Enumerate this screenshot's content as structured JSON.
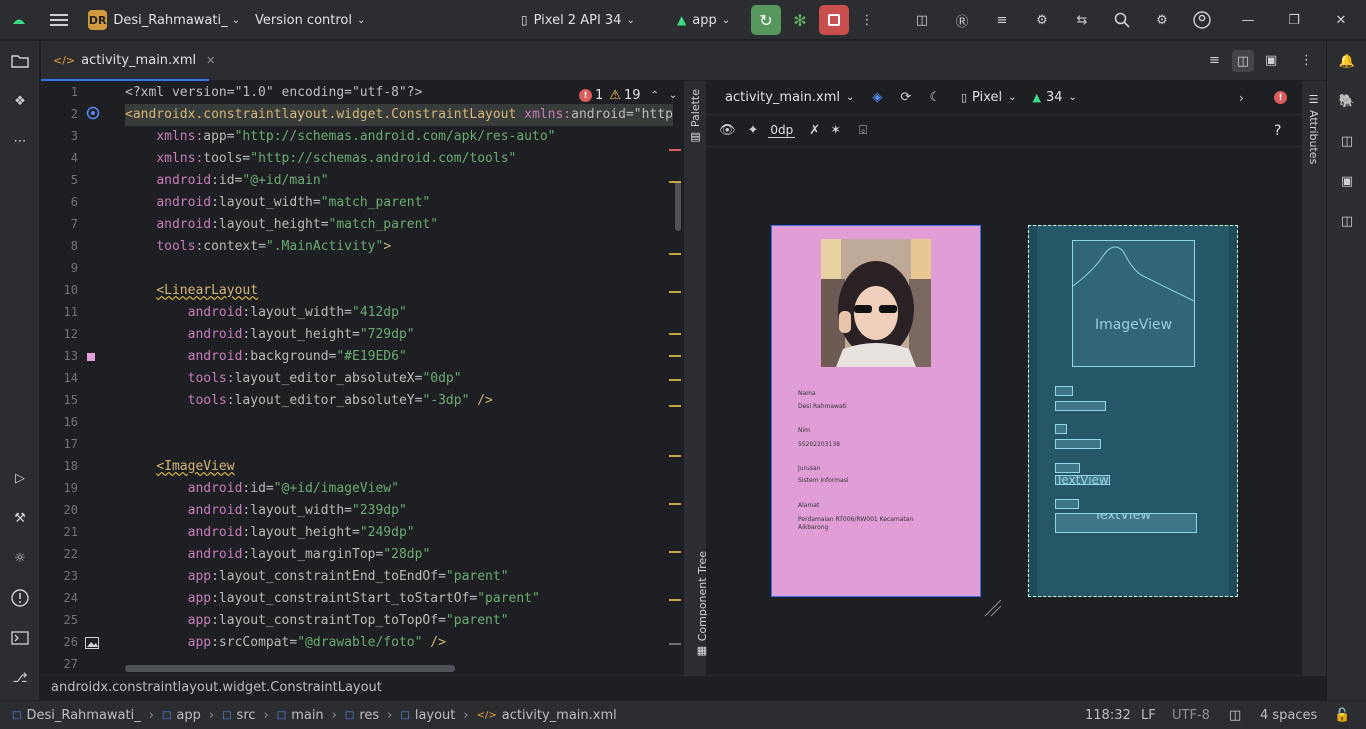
{
  "titlebar": {
    "project_badge": "DR",
    "project_name": "Desi_Rahmawati_",
    "vcs": "Version control",
    "device": "Pixel 2 API 34",
    "run_config": "app"
  },
  "tab": {
    "label": "activity_main.xml"
  },
  "editor": {
    "problems_errors": "1",
    "problems_warnings": "19",
    "line_numbers": [
      "1",
      "2",
      "3",
      "4",
      "5",
      "6",
      "7",
      "8",
      "9",
      "10",
      "11",
      "12",
      "13",
      "14",
      "15",
      "16",
      "17",
      "18",
      "19",
      "20",
      "21",
      "22",
      "23",
      "24",
      "25",
      "26",
      "27"
    ],
    "lines": [
      [
        {
          "c": "t-plain",
          "t": "<?xml version=\"1.0\" encoding=\"utf-8\"?>"
        }
      ],
      [
        {
          "c": "t-tag",
          "t": "<androidx.constraintlayout.widget.ConstraintLayout "
        },
        {
          "c": "t-ns",
          "t": "xmlns:"
        },
        {
          "c": "t-attr",
          "t": "android"
        },
        {
          "c": "t-plain",
          "t": "=\"http"
        }
      ],
      [
        {
          "c": "t-plain",
          "t": "    "
        },
        {
          "c": "t-ns",
          "t": "xmlns:"
        },
        {
          "c": "t-attr",
          "t": "app"
        },
        {
          "c": "t-plain",
          "t": "="
        },
        {
          "c": "t-val",
          "t": "\"http://schemas.android.com/apk/res-auto\""
        }
      ],
      [
        {
          "c": "t-plain",
          "t": "    "
        },
        {
          "c": "t-ns",
          "t": "xmlns:"
        },
        {
          "c": "t-attr",
          "t": "tools"
        },
        {
          "c": "t-plain",
          "t": "="
        },
        {
          "c": "t-val",
          "t": "\"http://schemas.android.com/tools\""
        }
      ],
      [
        {
          "c": "t-plain",
          "t": "    "
        },
        {
          "c": "t-ns",
          "t": "android"
        },
        {
          "c": "t-attr",
          "t": ":id"
        },
        {
          "c": "t-plain",
          "t": "="
        },
        {
          "c": "t-val",
          "t": "\"@+id/main\""
        }
      ],
      [
        {
          "c": "t-plain",
          "t": "    "
        },
        {
          "c": "t-ns",
          "t": "android"
        },
        {
          "c": "t-attr",
          "t": ":layout_width"
        },
        {
          "c": "t-plain",
          "t": "="
        },
        {
          "c": "t-val",
          "t": "\"match_parent\""
        }
      ],
      [
        {
          "c": "t-plain",
          "t": "    "
        },
        {
          "c": "t-ns",
          "t": "android"
        },
        {
          "c": "t-attr",
          "t": ":layout_height"
        },
        {
          "c": "t-plain",
          "t": "="
        },
        {
          "c": "t-val",
          "t": "\"match_parent\""
        }
      ],
      [
        {
          "c": "t-plain",
          "t": "    "
        },
        {
          "c": "t-ns",
          "t": "tools"
        },
        {
          "c": "t-attr",
          "t": ":context"
        },
        {
          "c": "t-plain",
          "t": "="
        },
        {
          "c": "t-val",
          "t": "\".MainActivity\""
        },
        {
          "c": "t-tag",
          "t": ">"
        }
      ],
      [
        {
          "c": "t-plain",
          "t": ""
        }
      ],
      [
        {
          "c": "t-plain",
          "t": "    "
        },
        {
          "c": "t-tag",
          "t": "<LinearLayout"
        }
      ],
      [
        {
          "c": "t-plain",
          "t": "        "
        },
        {
          "c": "t-ns",
          "t": "android"
        },
        {
          "c": "t-attr",
          "t": ":layout_width"
        },
        {
          "c": "t-plain",
          "t": "="
        },
        {
          "c": "t-val",
          "t": "\"412dp\""
        }
      ],
      [
        {
          "c": "t-plain",
          "t": "        "
        },
        {
          "c": "t-ns",
          "t": "android"
        },
        {
          "c": "t-attr",
          "t": ":layout_height"
        },
        {
          "c": "t-plain",
          "t": "="
        },
        {
          "c": "t-val",
          "t": "\"729dp\""
        }
      ],
      [
        {
          "c": "t-plain",
          "t": "        "
        },
        {
          "c": "t-ns",
          "t": "android"
        },
        {
          "c": "t-attr",
          "t": ":background"
        },
        {
          "c": "t-plain",
          "t": "="
        },
        {
          "c": "t-val",
          "t": "\"#E19ED6\""
        }
      ],
      [
        {
          "c": "t-plain",
          "t": "        "
        },
        {
          "c": "t-ns",
          "t": "tools"
        },
        {
          "c": "t-attr",
          "t": ":layout_editor_absoluteX"
        },
        {
          "c": "t-plain",
          "t": "="
        },
        {
          "c": "t-val",
          "t": "\"0dp\""
        }
      ],
      [
        {
          "c": "t-plain",
          "t": "        "
        },
        {
          "c": "t-ns",
          "t": "tools"
        },
        {
          "c": "t-attr",
          "t": ":layout_editor_absoluteY"
        },
        {
          "c": "t-plain",
          "t": "="
        },
        {
          "c": "t-val",
          "t": "\"-3dp\""
        },
        {
          "c": "t-tag",
          "t": " />"
        }
      ],
      [
        {
          "c": "t-plain",
          "t": ""
        }
      ],
      [
        {
          "c": "t-plain",
          "t": ""
        }
      ],
      [
        {
          "c": "t-plain",
          "t": "    "
        },
        {
          "c": "t-tag",
          "t": "<ImageView"
        }
      ],
      [
        {
          "c": "t-plain",
          "t": "        "
        },
        {
          "c": "t-ns",
          "t": "android"
        },
        {
          "c": "t-attr",
          "t": ":id"
        },
        {
          "c": "t-plain",
          "t": "="
        },
        {
          "c": "t-val",
          "t": "\"@+id/imageView\""
        }
      ],
      [
        {
          "c": "t-plain",
          "t": "        "
        },
        {
          "c": "t-ns",
          "t": "android"
        },
        {
          "c": "t-attr",
          "t": ":layout_width"
        },
        {
          "c": "t-plain",
          "t": "="
        },
        {
          "c": "t-val",
          "t": "\"239dp\""
        }
      ],
      [
        {
          "c": "t-plain",
          "t": "        "
        },
        {
          "c": "t-ns",
          "t": "android"
        },
        {
          "c": "t-attr",
          "t": ":layout_height"
        },
        {
          "c": "t-plain",
          "t": "="
        },
        {
          "c": "t-val",
          "t": "\"249dp\""
        }
      ],
      [
        {
          "c": "t-plain",
          "t": "        "
        },
        {
          "c": "t-ns",
          "t": "android"
        },
        {
          "c": "t-attr",
          "t": ":layout_marginTop"
        },
        {
          "c": "t-plain",
          "t": "="
        },
        {
          "c": "t-val",
          "t": "\"28dp\""
        }
      ],
      [
        {
          "c": "t-plain",
          "t": "        "
        },
        {
          "c": "t-ns",
          "t": "app"
        },
        {
          "c": "t-attr",
          "t": ":layout_constraintEnd_toEndOf"
        },
        {
          "c": "t-plain",
          "t": "="
        },
        {
          "c": "t-val",
          "t": "\"parent\""
        }
      ],
      [
        {
          "c": "t-plain",
          "t": "        "
        },
        {
          "c": "t-ns",
          "t": "app"
        },
        {
          "c": "t-attr",
          "t": ":layout_constraintStart_toStartOf"
        },
        {
          "c": "t-plain",
          "t": "="
        },
        {
          "c": "t-val",
          "t": "\"parent\""
        }
      ],
      [
        {
          "c": "t-plain",
          "t": "        "
        },
        {
          "c": "t-ns",
          "t": "app"
        },
        {
          "c": "t-attr",
          "t": ":layout_constraintTop_toTopOf"
        },
        {
          "c": "t-plain",
          "t": "="
        },
        {
          "c": "t-val",
          "t": "\"parent\""
        }
      ],
      [
        {
          "c": "t-plain",
          "t": "        "
        },
        {
          "c": "t-ns",
          "t": "app"
        },
        {
          "c": "t-attr",
          "t": ":srcCompat"
        },
        {
          "c": "t-plain",
          "t": "="
        },
        {
          "c": "t-val",
          "t": "\"@drawable/foto\""
        },
        {
          "c": "t-tag",
          "t": " />"
        }
      ],
      [
        {
          "c": "t-plain",
          "t": ""
        }
      ]
    ]
  },
  "side_tabs": {
    "palette": "Palette",
    "component_tree": "Component Tree",
    "attributes": "Attributes"
  },
  "design_toolbar": {
    "file": "activity_main.xml",
    "device": "Pixel",
    "api": "34",
    "margin": "0dp",
    "help": "?"
  },
  "preview": {
    "label_nama": "Nama",
    "value_nama": "Desi Rahmawati",
    "label_nim": "Nim",
    "value_nim": "55202203138",
    "label_jurusan": "Jurusan",
    "value_jurusan": "Sistem Informasi",
    "label_alamat": "Alamat",
    "value_alamat": "Perdamaian RT006/RW001 Kecamatan Aikbarong"
  },
  "blueprint": {
    "imageview": "ImageView",
    "textview1": "TextView",
    "textview2": "TextView"
  },
  "status": {
    "path": "androidx.constraintlayout.widget.ConstraintLayout"
  },
  "breadcrumbs": [
    "Desi_Rahmawati_",
    "app",
    "src",
    "main",
    "res",
    "layout",
    "activity_main.xml"
  ],
  "statusbar": {
    "position": "118:32",
    "line_sep": "LF",
    "encoding": "UTF-8",
    "indent": "4 spaces"
  },
  "colors": {
    "layout_bg": "#E19ED6",
    "blueprint_bg": "#255767",
    "run_green": "#57965c",
    "stop_red": "#c94f4f"
  }
}
